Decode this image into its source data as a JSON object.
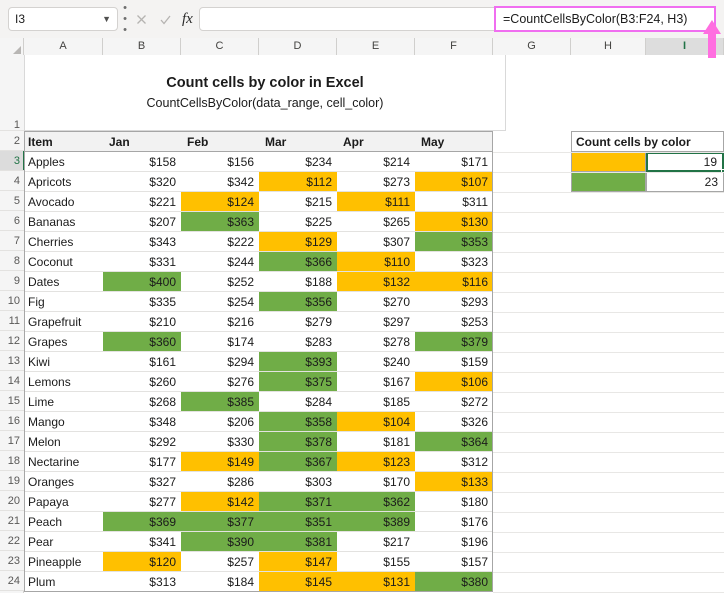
{
  "formula_bar": {
    "name_box_value": "I3",
    "formula": "=CountCellsByColor(B3:F24, H3)",
    "cancel_icon": "x-icon",
    "confirm_icon": "check-icon",
    "fx_icon": "fx-icon",
    "chevron_icon": "chevron-down-icon",
    "kebab_icon": "more-options-icon"
  },
  "columns": [
    "A",
    "B",
    "C",
    "D",
    "E",
    "F",
    "G",
    "H",
    "I"
  ],
  "selected_column": "I",
  "rows": [
    "1",
    "2",
    "3",
    "4",
    "5",
    "6",
    "7",
    "8",
    "9",
    "10",
    "11",
    "12",
    "13",
    "14",
    "15",
    "16",
    "17",
    "18",
    "19",
    "20",
    "21",
    "22",
    "23",
    "24"
  ],
  "selected_row": "3",
  "title": {
    "heading": "Count cells by color in Excel",
    "subheading": "CountCellsByColor(data_range, cell_color)"
  },
  "table": {
    "headers": [
      "Item",
      "Jan",
      "Feb",
      "Mar",
      "Apr",
      "May"
    ],
    "rows": [
      {
        "item": "Apples",
        "values": [
          "$158",
          "$156",
          "$234",
          "$214",
          "$171"
        ],
        "colors": [
          "none",
          "none",
          "none",
          "none",
          "none"
        ]
      },
      {
        "item": "Apricots",
        "values": [
          "$320",
          "$342",
          "$112",
          "$273",
          "$107"
        ],
        "colors": [
          "none",
          "none",
          "orange",
          "none",
          "orange"
        ]
      },
      {
        "item": "Avocado",
        "values": [
          "$221",
          "$124",
          "$215",
          "$111",
          "$311"
        ],
        "colors": [
          "none",
          "orange",
          "none",
          "orange",
          "none"
        ]
      },
      {
        "item": "Bananas",
        "values": [
          "$207",
          "$363",
          "$225",
          "$265",
          "$130"
        ],
        "colors": [
          "none",
          "green",
          "none",
          "none",
          "orange"
        ]
      },
      {
        "item": "Cherries",
        "values": [
          "$343",
          "$222",
          "$129",
          "$307",
          "$353"
        ],
        "colors": [
          "none",
          "none",
          "orange",
          "none",
          "green"
        ]
      },
      {
        "item": "Coconut",
        "values": [
          "$331",
          "$244",
          "$366",
          "$110",
          "$323"
        ],
        "colors": [
          "none",
          "none",
          "green",
          "orange",
          "none"
        ]
      },
      {
        "item": "Dates",
        "values": [
          "$400",
          "$252",
          "$188",
          "$132",
          "$116"
        ],
        "colors": [
          "green",
          "none",
          "none",
          "orange",
          "orange"
        ]
      },
      {
        "item": "Fig",
        "values": [
          "$335",
          "$254",
          "$356",
          "$270",
          "$293"
        ],
        "colors": [
          "none",
          "none",
          "green",
          "none",
          "none"
        ]
      },
      {
        "item": "Grapefruit",
        "values": [
          "$210",
          "$216",
          "$279",
          "$297",
          "$253"
        ],
        "colors": [
          "none",
          "none",
          "none",
          "none",
          "none"
        ]
      },
      {
        "item": "Grapes",
        "values": [
          "$360",
          "$174",
          "$283",
          "$278",
          "$379"
        ],
        "colors": [
          "green",
          "none",
          "none",
          "none",
          "green"
        ]
      },
      {
        "item": "Kiwi",
        "values": [
          "$161",
          "$294",
          "$393",
          "$240",
          "$159"
        ],
        "colors": [
          "none",
          "none",
          "green",
          "none",
          "none"
        ]
      },
      {
        "item": "Lemons",
        "values": [
          "$260",
          "$276",
          "$375",
          "$167",
          "$106"
        ],
        "colors": [
          "none",
          "none",
          "green",
          "none",
          "orange"
        ]
      },
      {
        "item": "Lime",
        "values": [
          "$268",
          "$385",
          "$284",
          "$185",
          "$272"
        ],
        "colors": [
          "none",
          "green",
          "none",
          "none",
          "none"
        ]
      },
      {
        "item": "Mango",
        "values": [
          "$348",
          "$206",
          "$358",
          "$104",
          "$326"
        ],
        "colors": [
          "none",
          "none",
          "green",
          "orange",
          "none"
        ]
      },
      {
        "item": "Melon",
        "values": [
          "$292",
          "$330",
          "$378",
          "$181",
          "$364"
        ],
        "colors": [
          "none",
          "none",
          "green",
          "none",
          "green"
        ]
      },
      {
        "item": "Nectarine",
        "values": [
          "$177",
          "$149",
          "$367",
          "$123",
          "$312"
        ],
        "colors": [
          "none",
          "orange",
          "green",
          "orange",
          "none"
        ]
      },
      {
        "item": "Oranges",
        "values": [
          "$327",
          "$286",
          "$303",
          "$170",
          "$133"
        ],
        "colors": [
          "none",
          "none",
          "none",
          "none",
          "orange"
        ]
      },
      {
        "item": "Papaya",
        "values": [
          "$277",
          "$142",
          "$371",
          "$362",
          "$180"
        ],
        "colors": [
          "none",
          "orange",
          "green",
          "green",
          "none"
        ]
      },
      {
        "item": "Peach",
        "values": [
          "$369",
          "$377",
          "$351",
          "$389",
          "$176"
        ],
        "colors": [
          "green",
          "green",
          "green",
          "green",
          "none"
        ]
      },
      {
        "item": "Pear",
        "values": [
          "$341",
          "$390",
          "$381",
          "$217",
          "$196"
        ],
        "colors": [
          "none",
          "green",
          "green",
          "none",
          "none"
        ]
      },
      {
        "item": "Pineapple",
        "values": [
          "$120",
          "$257",
          "$147",
          "$155",
          "$157"
        ],
        "colors": [
          "orange",
          "none",
          "orange",
          "none",
          "none"
        ]
      },
      {
        "item": "Plum",
        "values": [
          "$313",
          "$184",
          "$145",
          "$131",
          "$380"
        ],
        "colors": [
          "none",
          "none",
          "orange",
          "orange",
          "green"
        ]
      }
    ]
  },
  "panel": {
    "header": "Count cells by color",
    "entries": [
      {
        "swatch": "orange",
        "count": "19"
      },
      {
        "swatch": "green",
        "count": "23"
      }
    ]
  },
  "colors": {
    "orange": "#ffc000",
    "green": "#70ad47",
    "highlight_border": "#f06ef0",
    "selection_border": "#217346"
  }
}
